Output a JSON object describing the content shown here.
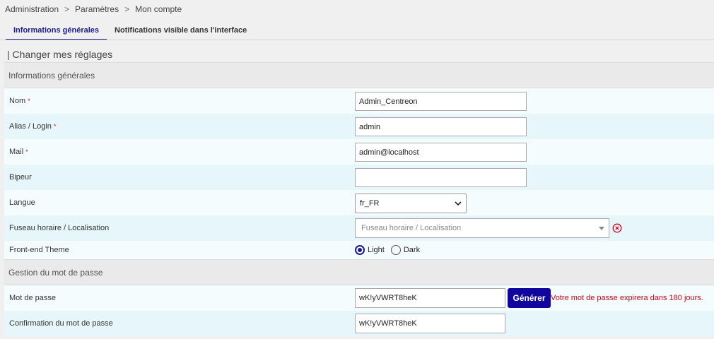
{
  "breadcrumb": {
    "items": [
      "Administration",
      "Paramètres",
      "Mon compte"
    ],
    "separator": ">"
  },
  "tabs": [
    {
      "label": "Informations générales",
      "active": true
    },
    {
      "label": "Notifications visible dans l'interface",
      "active": false
    }
  ],
  "page_title": "| Changer mes réglages",
  "sections": {
    "general": {
      "title": "Informations générales",
      "fields": {
        "nom": {
          "label": "Nom",
          "required_mark": "*",
          "value": "Admin_Centreon"
        },
        "alias": {
          "label": "Alias / Login",
          "required_mark": "*",
          "value": "admin"
        },
        "mail": {
          "label": "Mail",
          "required_mark": "*",
          "value": "admin@localhost"
        },
        "bipeur": {
          "label": "Bipeur",
          "value": ""
        },
        "langue": {
          "label": "Langue",
          "value": "fr_FR"
        },
        "fuseau": {
          "label": "Fuseau horaire / Localisation",
          "placeholder": "Fuseau horaire / Localisation"
        },
        "theme": {
          "label": "Front-end Theme",
          "options": [
            "Light",
            "Dark"
          ],
          "selected": "Light"
        }
      }
    },
    "password": {
      "title": "Gestion du mot de passe",
      "fields": {
        "password": {
          "label": "Mot de passe",
          "value": "wK!yVWRT8heK"
        },
        "generate_label": "Générer",
        "expiry_message": "Votre mot de passe expirera dans 180 jours.",
        "confirm": {
          "label": "Confirmation du mot de passe",
          "value": "wK!yVWRT8heK"
        }
      }
    }
  },
  "colors": {
    "accent": "#1c1c8e",
    "button": "#10069f",
    "required": "#c8102e",
    "warning": "#d0021b"
  },
  "icons": {
    "langue_select": "chevron-down-icon",
    "fuseau_clear": "clear-circle-icon"
  }
}
